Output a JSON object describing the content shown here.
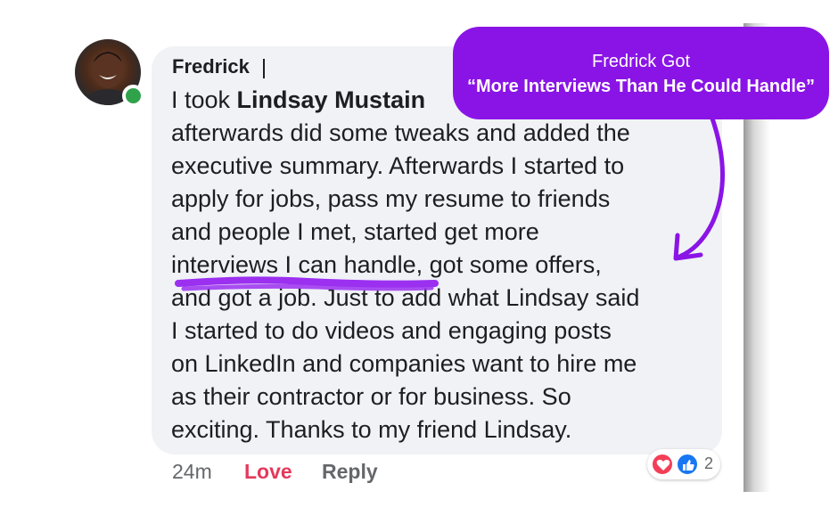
{
  "callout": {
    "line1": "Fredrick Got",
    "line2": "“More Interviews Than He Could Handle”"
  },
  "comment": {
    "author": "Fredrick",
    "lines": [
      [
        "I took ",
        "Lindsay Mustain",
        ""
      ],
      [
        "afterwards did some tweaks and added the",
        "",
        ""
      ],
      [
        "executive summary. Afterwards I started to",
        "",
        ""
      ],
      [
        "apply for jobs, pass my resume to friends",
        "",
        ""
      ],
      [
        "and people I met, started get more",
        "",
        ""
      ],
      [
        "interviews I can handle, got some offers,",
        "",
        ""
      ],
      [
        "and got a job. Just to add what Lindsay said",
        "",
        ""
      ],
      [
        "I started to do videos and engaging posts",
        "",
        ""
      ],
      [
        "on LinkedIn and companies want to hire me",
        "",
        ""
      ],
      [
        "as their contractor or for business. So",
        "",
        ""
      ],
      [
        "exciting. Thanks to my friend Lindsay.",
        "",
        ""
      ]
    ]
  },
  "footer": {
    "time": "24m",
    "love_label": "Love",
    "reply_label": "Reply",
    "reaction_count": "2"
  },
  "colors": {
    "callout_bg": "#8a14e6",
    "highlight": "#9b30f0",
    "love": "#e4395b",
    "online": "#31a24c"
  }
}
